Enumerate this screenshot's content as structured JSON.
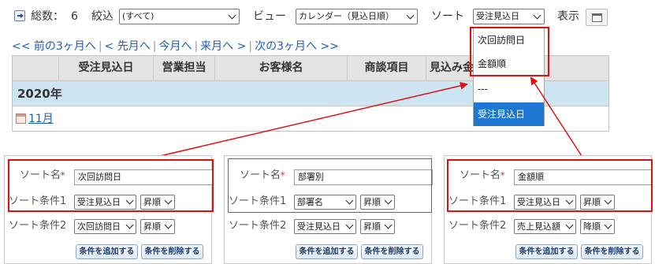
{
  "toolbar": {
    "total_label": "総数：",
    "total_count": "6",
    "filter_label": "絞込",
    "filter_value": "(すべて)",
    "view_label": "ビュー",
    "view_value": "カレンダー（見込日順）",
    "sort_label": "ソート",
    "sort_value": "受注見込日",
    "display_label": "表示"
  },
  "nav": {
    "prev3": "<< 前の3ヶ月へ",
    "prev": "< 先月へ",
    "current": "今月へ",
    "next": "来月へ >",
    "next3": "次の3ヶ月へ >>"
  },
  "table": {
    "headers": [
      "受注見込日",
      "営業担当",
      "お客様名",
      "商談項目",
      "見込み金"
    ],
    "year": "2020年",
    "month": "11月"
  },
  "sort_dropdown": {
    "options": [
      "次回訪問日",
      "金額順",
      "---",
      "受注見込日"
    ],
    "selected": "受注見込日"
  },
  "panels": [
    {
      "sort_name_label": "ソート名",
      "sort_name_value": "次回訪問日",
      "cond1_label": "ソート条件1",
      "cond1_field": "受注見込日",
      "cond1_order": "昇順",
      "cond2_label": "ソート条件2",
      "cond2_field": "次回訪問日",
      "cond2_order": "昇順",
      "add_button": "条件を追加する",
      "delete_button": "条件を削除する"
    },
    {
      "sort_name_label": "ソート名",
      "sort_name_value": "部署別",
      "cond1_label": "ソート条件1",
      "cond1_field": "部署名",
      "cond1_order": "昇順",
      "cond2_label": "ソート条件2",
      "cond2_field": "受注見込日",
      "cond2_order": "昇順",
      "add_button": "条件を追加する",
      "delete_button": "条件を削除する"
    },
    {
      "sort_name_label": "ソート名",
      "sort_name_value": "金額順",
      "cond1_label": "ソート条件1",
      "cond1_field": "受注見込日",
      "cond1_order": "昇順",
      "cond2_label": "ソート条件2",
      "cond2_field": "売上見込額",
      "cond2_order": "降順",
      "add_button": "条件を追加する",
      "delete_button": "条件を削除する"
    }
  ],
  "colors": {
    "highlight_red": "#e01010",
    "highlight_green": "#2a8d3c",
    "link_blue": "#1a5fc2",
    "selected_option": "#1e77d3",
    "year_row": "#cde4f2"
  }
}
